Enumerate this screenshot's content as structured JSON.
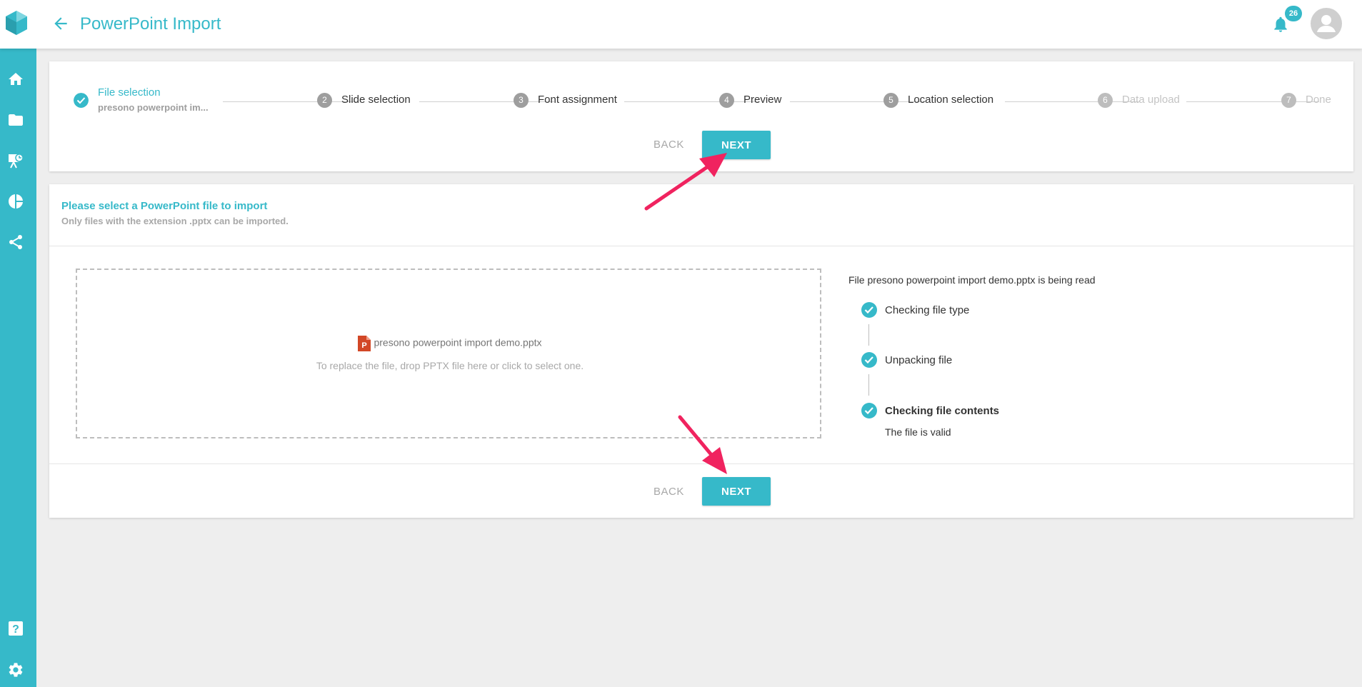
{
  "header": {
    "title": "PowerPoint Import",
    "notification_count": "26"
  },
  "sidebar": {
    "items": [
      {
        "name": "home-icon"
      },
      {
        "name": "folder-icon"
      },
      {
        "name": "presentation-icon"
      },
      {
        "name": "pie-chart-icon"
      },
      {
        "name": "share-icon"
      }
    ],
    "bottom": [
      {
        "name": "help-icon"
      },
      {
        "name": "gear-icon"
      }
    ]
  },
  "stepper": {
    "steps": [
      {
        "number": "1",
        "label": "File selection",
        "sub": "presono powerpoint im...",
        "state": "done"
      },
      {
        "number": "2",
        "label": "Slide selection",
        "state": "pending"
      },
      {
        "number": "3",
        "label": "Font assignment",
        "state": "pending"
      },
      {
        "number": "4",
        "label": "Preview",
        "state": "pending"
      },
      {
        "number": "5",
        "label": "Location selection",
        "state": "pending"
      },
      {
        "number": "6",
        "label": "Data upload",
        "state": "disabled"
      },
      {
        "number": "7",
        "label": "Done",
        "state": "disabled"
      }
    ],
    "back_label": "BACK",
    "next_label": "NEXT"
  },
  "main": {
    "title": "Please select a PowerPoint file to import",
    "subtitle": "Only files with the extension .pptx can be imported.",
    "dropzone": {
      "file_name": "presono powerpoint import demo.pptx",
      "hint": "To replace the file, drop PPTX file here or click to select one."
    },
    "status": {
      "title": "File presono powerpoint import demo.pptx is being read",
      "checks": [
        {
          "label": "Checking file type"
        },
        {
          "label": "Unpacking file"
        },
        {
          "label": "Checking file contents"
        }
      ],
      "result": "The file is valid"
    },
    "back_label": "BACK",
    "next_label": "NEXT"
  },
  "colors": {
    "accent": "#36b9c9",
    "annotation_arrow": "#f0235f"
  }
}
